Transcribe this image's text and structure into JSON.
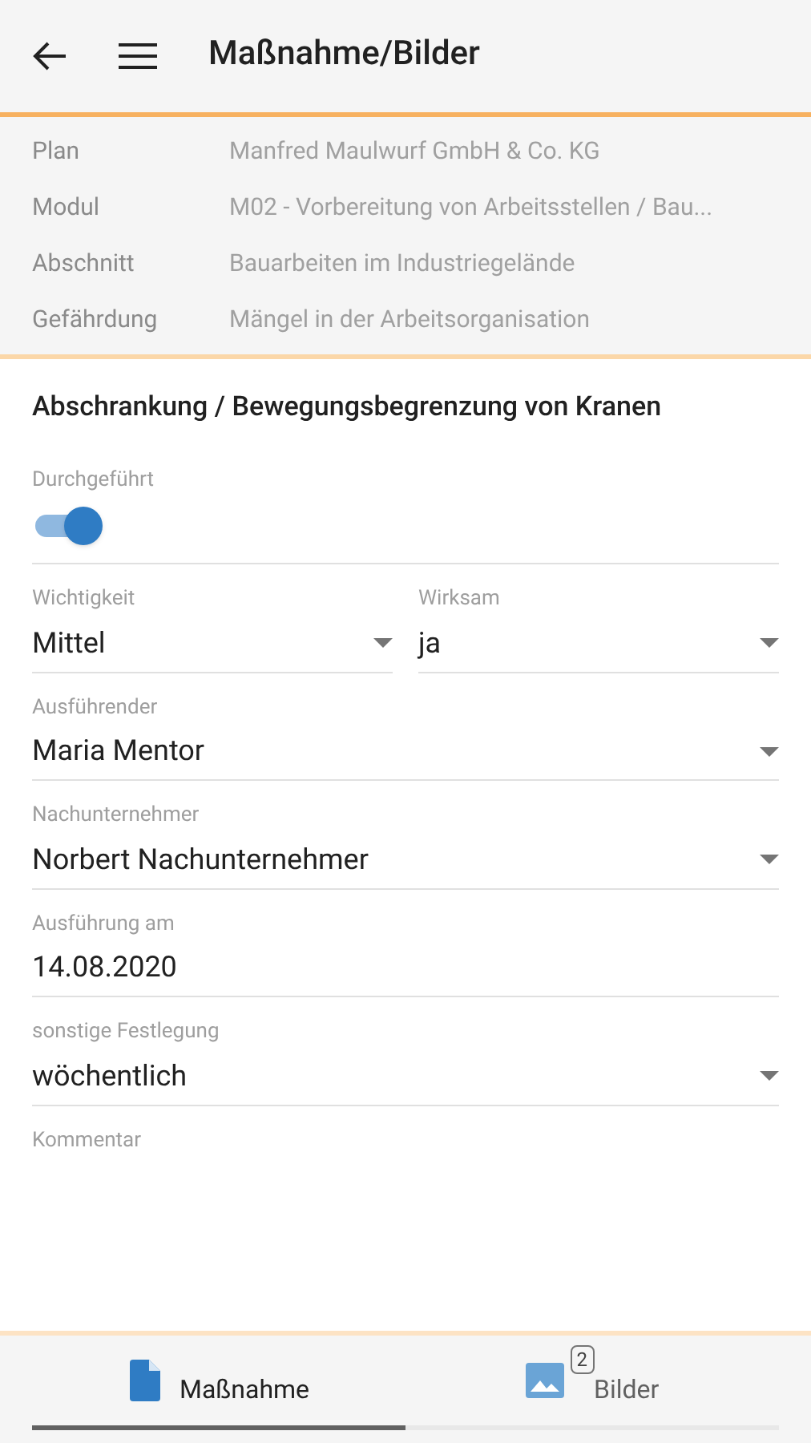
{
  "header": {
    "title": "Maßnahme/Bilder"
  },
  "info": [
    {
      "label": "Plan",
      "value": "Manfred Maulwurf GmbH & Co. KG"
    },
    {
      "label": "Modul",
      "value": "M02 - Vorbereitung von Arbeitsstellen / Bau..."
    },
    {
      "label": "Abschnitt",
      "value": "Bauarbeiten im Industriegelände"
    },
    {
      "label": "Gefährdung",
      "value": "Mängel in der Arbeitsorganisation"
    }
  ],
  "section_title": "Abschrankung / Bewegungsbegrenzung von Kranen",
  "fields": [
    {
      "kind": "toggle",
      "label": "Durchgeführt",
      "on": true
    },
    {
      "kind": "row",
      "items": [
        {
          "kind": "select",
          "label": "Wichtigkeit",
          "value": "Mittel"
        },
        {
          "kind": "select",
          "label": "Wirksam",
          "value": "ja"
        }
      ]
    },
    {
      "kind": "select",
      "label": "Ausführender",
      "value": "Maria Mentor"
    },
    {
      "kind": "select",
      "label": "Nachunternehmer",
      "value": "Norbert Nachunternehmer"
    },
    {
      "kind": "text",
      "label": "Ausführung am",
      "value": "14.08.2020"
    },
    {
      "kind": "select",
      "label": "sonstige Festlegung",
      "value": "wöchentlich"
    },
    {
      "kind": "comment",
      "label": "Kommentar"
    }
  ],
  "tabs": [
    {
      "label": "Maßnahme",
      "selected": true
    },
    {
      "label": "Bilder",
      "selected": false,
      "badge": "2"
    }
  ]
}
